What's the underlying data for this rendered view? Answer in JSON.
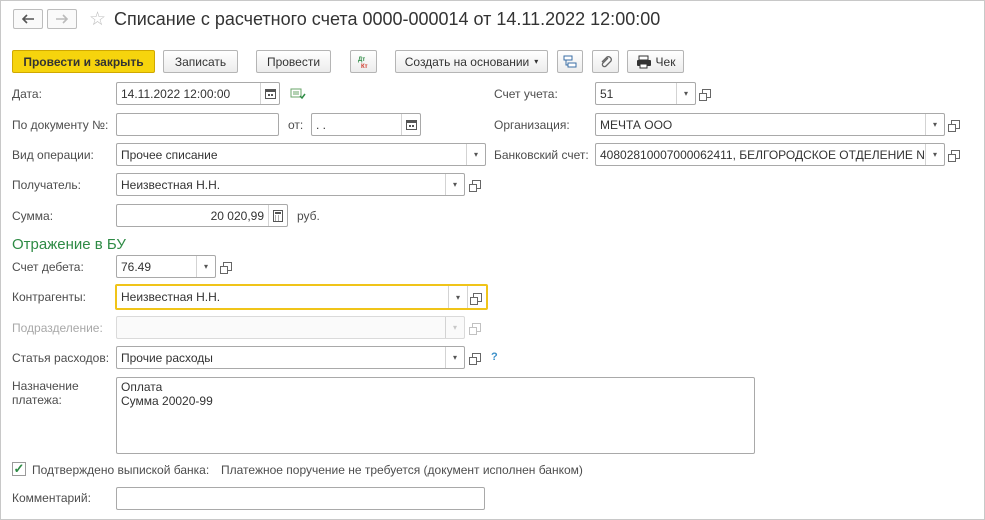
{
  "window": {
    "title": "Списание с расчетного счета 0000-000014 от 14.11.2022 12:00:00"
  },
  "toolbar": {
    "post_close": "Провести и закрыть",
    "save": "Записать",
    "post": "Провести",
    "dt_kt": "Дт\nКт",
    "create_based": "Создать на основании",
    "receipt": "Чек"
  },
  "form": {
    "date_label": "Дата:",
    "date_value": "14.11.2022 12:00:00",
    "doc_no_label": "По документу №:",
    "doc_no_value": "",
    "from_label": "от:",
    "from_value": " .  .",
    "operation_label": "Вид операции:",
    "operation_value": "Прочее списание",
    "recipient_label": "Получатель:",
    "recipient_value": "Неизвестная Н.Н.",
    "amount_label": "Сумма:",
    "amount_value": "20 020,99",
    "currency": "руб.",
    "account_label": "Счет учета:",
    "account_value": "51",
    "org_label": "Организация:",
    "org_value": "МЕЧТА ООО",
    "bank_account_label": "Банковский счет:",
    "bank_account_value": "40802810007000062411, БЕЛГОРОДСКОЕ ОТДЕЛЕНИЕ N"
  },
  "accounting": {
    "section_title": "Отражение в БУ",
    "debit_label": "Счет дебета:",
    "debit_value": "76.49",
    "counterparty_label": "Контрагенты:",
    "counterparty_value": "Неизвестная Н.Н.",
    "division_label": "Подразделение:",
    "division_value": "",
    "expense_label": "Статья расходов:",
    "expense_value": "Прочие расходы",
    "help": "?"
  },
  "payment": {
    "purpose_label_1": "Назначение",
    "purpose_label_2": "платежа:",
    "purpose_line_1": "Оплата",
    "purpose_line_2": "Сумма 20020-99",
    "confirmed_label": "Подтверждено выпиской банка:",
    "confirmed": true,
    "confirmed_note": "Платежное поручение не требуется (документ исполнен банком)",
    "comment_label": "Комментарий:",
    "comment_value": ""
  },
  "colors": {
    "primary_button": "#f6d40d",
    "section_green": "#2e8b45",
    "focus_border": "#f0c419"
  },
  "icons": [
    "back-arrow-icon",
    "forward-arrow-icon",
    "star-icon",
    "calendar-icon",
    "dropdown-arrow-icon",
    "open-icon",
    "structure-icon",
    "paperclip-icon",
    "printer-icon",
    "checkmark-icon"
  ]
}
